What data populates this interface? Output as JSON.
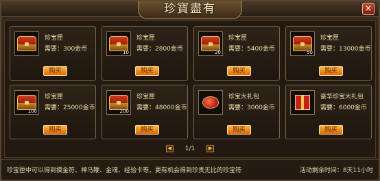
{
  "window": {
    "title": "珍寶盡有",
    "close_glyph": "×"
  },
  "items": [
    {
      "name": "珍宝匣",
      "price": "需要：300金币",
      "qty": "",
      "icon": "treasure-chest-icon",
      "buy_label": "购买"
    },
    {
      "name": "珍宝匣",
      "price": "需要：2800金币",
      "qty": "10",
      "icon": "treasure-chest-icon",
      "buy_label": "购买"
    },
    {
      "name": "珍宝匣",
      "price": "需要：5400金币",
      "qty": "20",
      "icon": "treasure-chest-icon",
      "buy_label": "购买"
    },
    {
      "name": "珍宝匣",
      "price": "需要：13000金币",
      "qty": "50",
      "icon": "treasure-chest-icon",
      "buy_label": "购买"
    },
    {
      "name": "珍宝匣",
      "price": "需要：25000金币",
      "qty": "100",
      "icon": "treasure-chest-icon",
      "buy_label": "购买"
    },
    {
      "name": "珍宝匣",
      "price": "需要：48000金币",
      "qty": "200",
      "icon": "treasure-chest-icon",
      "buy_label": "购买"
    },
    {
      "name": "珍宝大礼包",
      "price": "需要：3000金币",
      "qty": "",
      "icon": "gift-bag-icon",
      "buy_label": "购买"
    },
    {
      "name": "豪华珍宝大礼包",
      "price": "需要：6000金币",
      "qty": "",
      "icon": "gift-box-icon",
      "buy_label": "购买"
    }
  ],
  "pager": {
    "label": "1/1",
    "prev": "◀",
    "next": "▶"
  },
  "footer": {
    "description": "珍宝匣中可以得到摸金符、神马鞭、金魂、经验卡等，更有机会得到珍贵无比的珍宝符",
    "timer": "活动剩余时间：8天11小时"
  },
  "colors": {
    "accent": "#f0dca8",
    "button": "#e88a1c"
  }
}
